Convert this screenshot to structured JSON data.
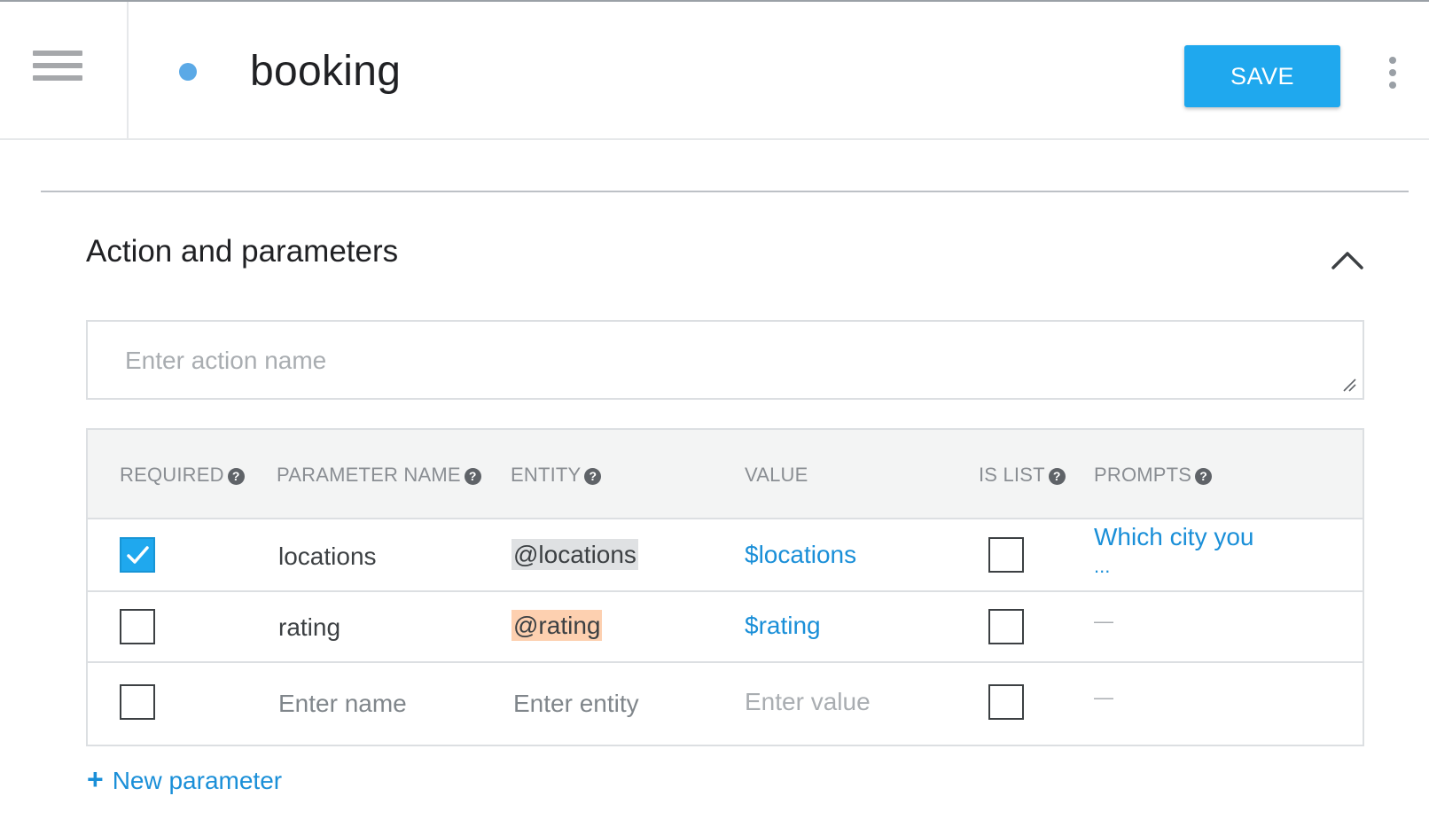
{
  "header": {
    "intent_name": "booking",
    "save_label": "SAVE"
  },
  "section": {
    "title": "Action and parameters",
    "action_placeholder": "Enter action name"
  },
  "table": {
    "columns": {
      "required": "REQUIRED",
      "parameter_name": "PARAMETER NAME",
      "entity": "ENTITY",
      "value": "VALUE",
      "is_list": "IS LIST",
      "prompts": "PROMPTS"
    },
    "rows": [
      {
        "required": true,
        "name": "locations",
        "entity": "@locations",
        "value": "$locations",
        "is_list": false,
        "prompt": "Which city you",
        "prompt_more": "..."
      },
      {
        "required": false,
        "name": "rating",
        "entity": "@rating",
        "value": "$rating",
        "is_list": false,
        "prompt": "—"
      }
    ],
    "new_row": {
      "name_placeholder": "Enter name",
      "entity_placeholder": "Enter entity",
      "value_placeholder": "Enter value",
      "prompt": "—"
    }
  },
  "new_parameter": {
    "icon": "+",
    "label": "New parameter"
  },
  "colors": {
    "accent": "#1fa8ee",
    "link": "#1a8fd8",
    "status_dot": "#5ba9e6",
    "entity_locations_bg": "#dfe1e3",
    "entity_rating_bg": "#fdd0b0"
  }
}
